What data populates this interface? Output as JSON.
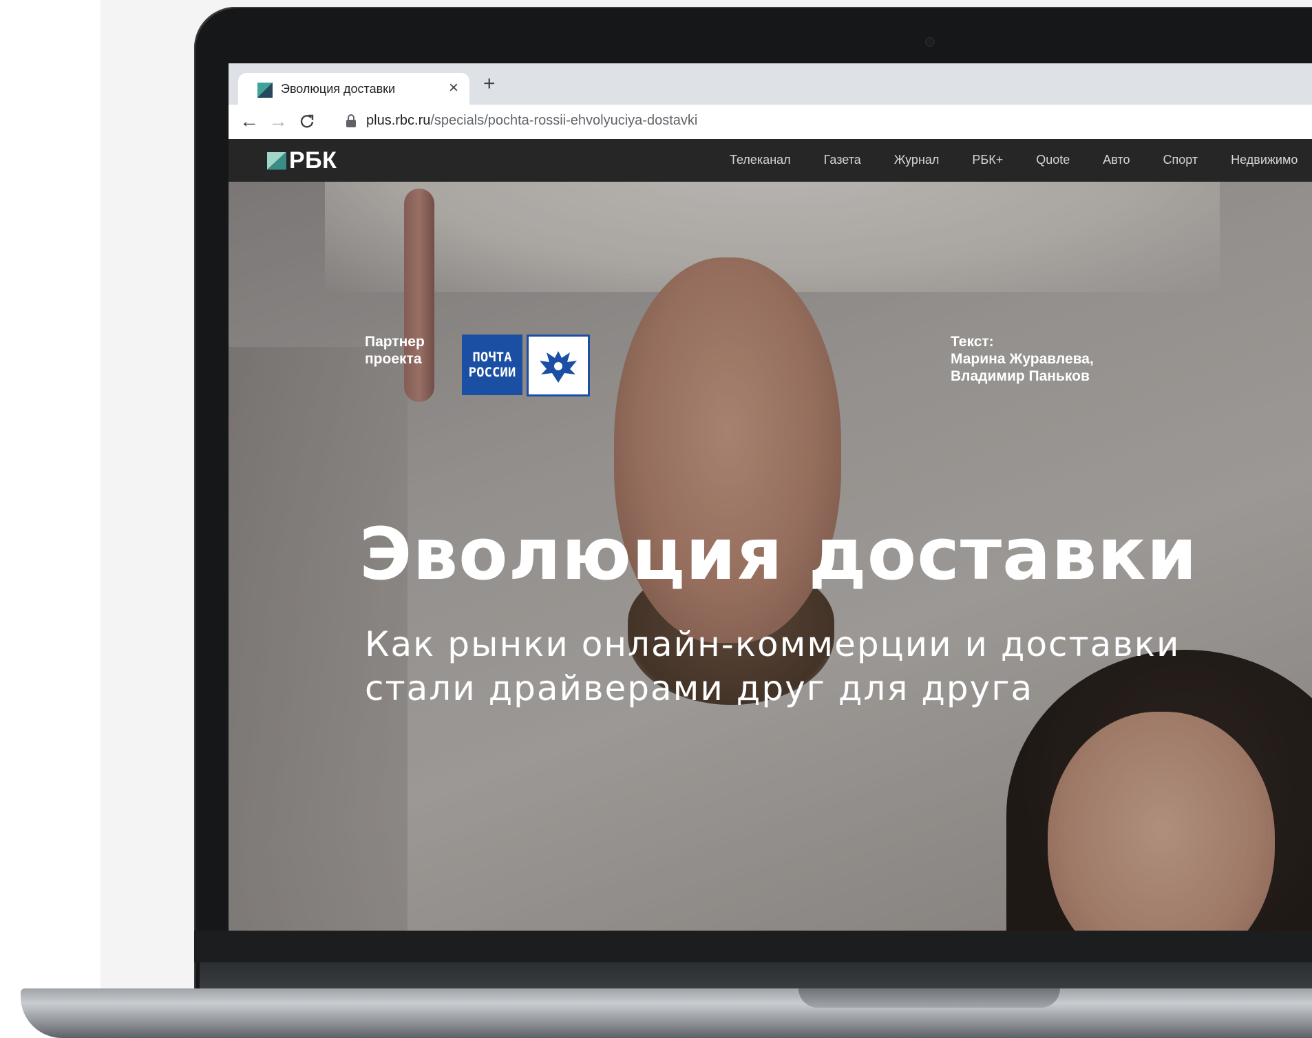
{
  "browser": {
    "tab_title": "Эволюция доставки",
    "tab_close": "×",
    "new_tab": "+",
    "back_icon": "←",
    "forward_icon": "→",
    "reload_icon": "C",
    "url_host": "plus.rbc.ru",
    "url_path": "/specials/pochta-rossii-ehvolyuciya-dostavki"
  },
  "site": {
    "logo_text": "РБК",
    "nav": [
      "Телеканал",
      "Газета",
      "Журнал",
      "РБК+",
      "Quote",
      "Авто",
      "Спорт",
      "Недвижимо"
    ]
  },
  "hero": {
    "partner_label_line1": "Партнер",
    "partner_label_line2": "проекта",
    "partner_logo_line1": "ПОЧТА",
    "partner_logo_line2": "РОССИИ",
    "credits_label": "Текст:",
    "credits_author1": "Марина Журавлева,",
    "credits_author2": "Владимир Паньков",
    "title": "Эволюция доставки",
    "subtitle_line1": "Как рынки онлайн-коммерции и доставки",
    "subtitle_line2": "стали драйверами друг для друга"
  },
  "colors": {
    "site_nav_bg": "#262626",
    "partner_blue": "#1a4fa3",
    "tabbar_bg": "#dee1e6"
  }
}
